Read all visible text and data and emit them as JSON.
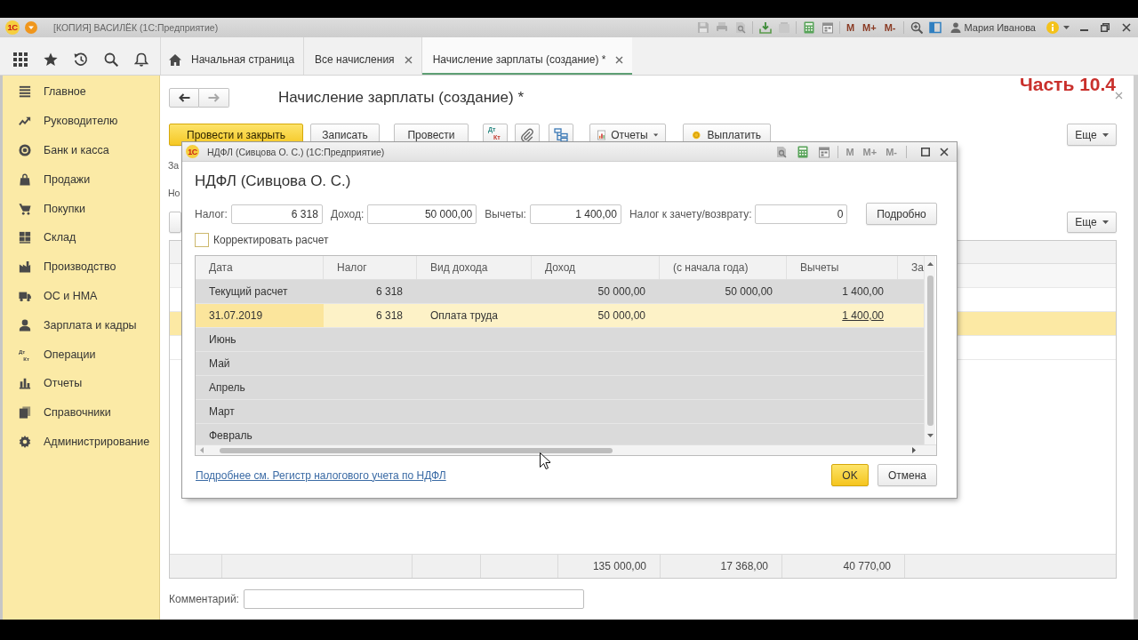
{
  "window": {
    "logo_text": "1С",
    "title": "[КОПИЯ] ВАСИЛЁК (1С:Предприятие)",
    "memory_buttons": [
      {
        "label": "M",
        "disabled": false
      },
      {
        "label": "M+",
        "disabled": false
      },
      {
        "label": "M-",
        "disabled": false
      }
    ],
    "user": "Мария Иванова"
  },
  "tabs": [
    {
      "label": "Начальная страница",
      "kind": "home",
      "selected": false
    },
    {
      "label": "Все начисления",
      "kind": "closable",
      "selected": false
    },
    {
      "label": "Начисление зарплаты (создание) *",
      "kind": "closable",
      "selected": true
    }
  ],
  "sidebar": {
    "items": [
      {
        "label": "Главное"
      },
      {
        "label": "Руководителю"
      },
      {
        "label": "Банк и касса"
      },
      {
        "label": "Продажи"
      },
      {
        "label": "Покупки"
      },
      {
        "label": "Склад"
      },
      {
        "label": "Производство"
      },
      {
        "label": "ОС и НМА"
      },
      {
        "label": "Зарплата и кадры"
      },
      {
        "label": "Операции",
        "icon_letters": [
          "Дт",
          "Кт"
        ]
      },
      {
        "label": "Отчеты"
      },
      {
        "label": "Справочники"
      },
      {
        "label": "Администрирование"
      }
    ]
  },
  "caption": "Часть 10.4",
  "document": {
    "title": "Начисление зарплаты (создание) *",
    "toolbar": [
      {
        "kind": "primary",
        "label": "Провести и закрыть"
      },
      {
        "kind": "plain",
        "label": "Записать"
      },
      {
        "kind": "plain",
        "label": "Провести"
      },
      {
        "kind": "dtkt",
        "letters": [
          "Дт",
          "Кт"
        ]
      },
      {
        "kind": "attach"
      },
      {
        "kind": "structure"
      },
      {
        "kind": "menu",
        "label": "Отчеты"
      },
      {
        "kind": "pay",
        "label": "Выплатить"
      }
    ],
    "more_button": "Еще",
    "field_labels": [
      "За",
      "Но"
    ],
    "table_more_button": "Еще",
    "table": {
      "rows": [
        {
          "selected": false
        },
        {
          "selected": false
        },
        {
          "selected": true
        },
        {
          "selected": false
        }
      ],
      "totals": [
        "135 000,00",
        "17 368,00",
        "40 770,00"
      ]
    },
    "comment": {
      "label": "Комментарий:"
    }
  },
  "dialog": {
    "logo_text": "1С",
    "title": "НДФЛ (Сивцова О. С.) (1С:Предприятие)",
    "memory_buttons": [
      {
        "label": "M",
        "disabled": true
      },
      {
        "label": "M+",
        "disabled": true
      },
      {
        "label": "M-",
        "disabled": true
      }
    ],
    "heading": "НДФЛ (Сивцова О. С.)",
    "fields": [
      {
        "label": "Налог:",
        "value": "6 318"
      },
      {
        "label": "Доход:",
        "value": "50 000,00"
      },
      {
        "label": "Вычеты:",
        "value": "1 400,00"
      },
      {
        "label": "Налог к зачету/возврату:",
        "value": "0"
      }
    ],
    "details_button": "Подробно",
    "correct_checkbox": {
      "label": "Корректировать расчет",
      "checked": false
    },
    "table": {
      "columns": [
        "Дата",
        "Налог",
        "Вид дохода",
        "Доход",
        "(с начала года)",
        "Вычеты",
        "За"
      ],
      "rows": [
        {
          "selected": false,
          "cells": [
            {
              "text": "Текущий расчет",
              "link": false
            },
            {
              "text": "6 318",
              "link": false
            },
            null,
            {
              "text": "50 000,00",
              "link": false
            },
            {
              "text": "50 000,00",
              "link": false
            },
            {
              "text": "1 400,00",
              "link": false
            },
            null
          ]
        },
        {
          "selected": true,
          "cells": [
            {
              "text": "31.07.2019",
              "link": false
            },
            {
              "text": "6 318",
              "link": false
            },
            {
              "text": "Оплата труда",
              "link": false
            },
            {
              "text": "50 000,00",
              "link": false
            },
            null,
            {
              "text": "1 400,00",
              "link": true
            },
            null
          ]
        },
        {
          "selected": false,
          "cells": [
            {
              "text": "Июнь",
              "link": false
            }
          ]
        },
        {
          "selected": false,
          "cells": [
            {
              "text": "Май",
              "link": false
            }
          ]
        },
        {
          "selected": false,
          "cells": [
            {
              "text": "Апрель",
              "link": false
            }
          ]
        },
        {
          "selected": false,
          "cells": [
            {
              "text": "Март",
              "link": false
            }
          ]
        },
        {
          "selected": false,
          "cells": [
            {
              "text": "Февраль",
              "link": false
            }
          ]
        }
      ]
    },
    "link": "Подробнее см. Регистр налогового учета по НДФЛ",
    "buttons": [
      {
        "label": "OK",
        "kind": "default"
      },
      {
        "label": "Отмена",
        "kind": "plain"
      }
    ]
  }
}
